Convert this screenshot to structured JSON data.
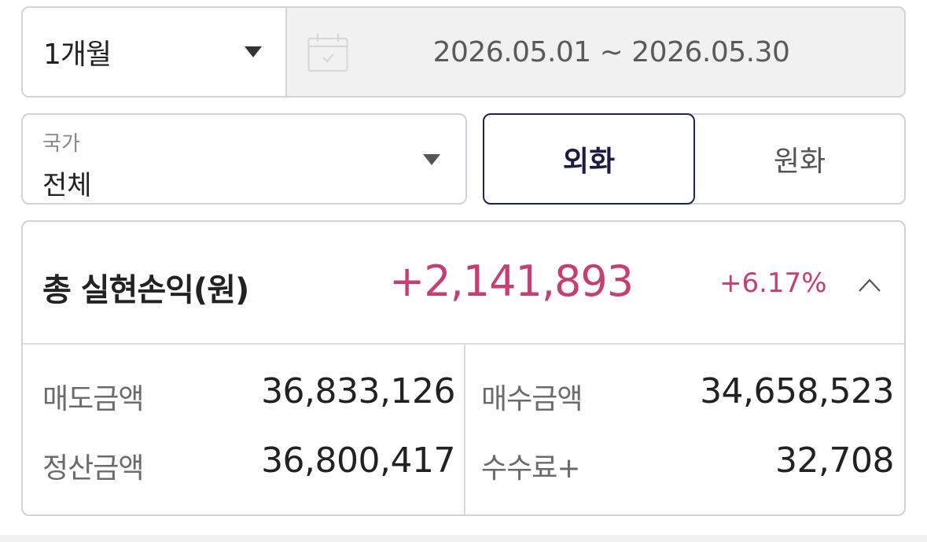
{
  "filters": {
    "period": {
      "label": "1개월",
      "icon": "caret-down-icon"
    },
    "date_range": {
      "text": "2026.05.01 ~ 2026.05.30",
      "icon": "calendar-icon"
    },
    "country": {
      "caption": "국가",
      "value": "전체",
      "icon": "caret-down-icon"
    },
    "currency": {
      "options": [
        "외화",
        "원화"
      ],
      "selected": "외화"
    }
  },
  "summary": {
    "title": "총 실현손익(원)",
    "amount": "+2,141,893",
    "rate": "+6.17%",
    "toggle_icon": "chevron-up-icon",
    "rows": [
      {
        "label": "매도금액",
        "value": "36,833,126"
      },
      {
        "label": "매수금액",
        "value": "34,658,523"
      },
      {
        "label": "정산금액",
        "value": "36,800,417"
      },
      {
        "label": "수수료+",
        "value": "32,708"
      }
    ]
  },
  "colors": {
    "accent_profit": "#c63f72",
    "selected_border": "#1f2454",
    "border": "#d3d3d3",
    "date_bg": "#f1f1f1"
  }
}
